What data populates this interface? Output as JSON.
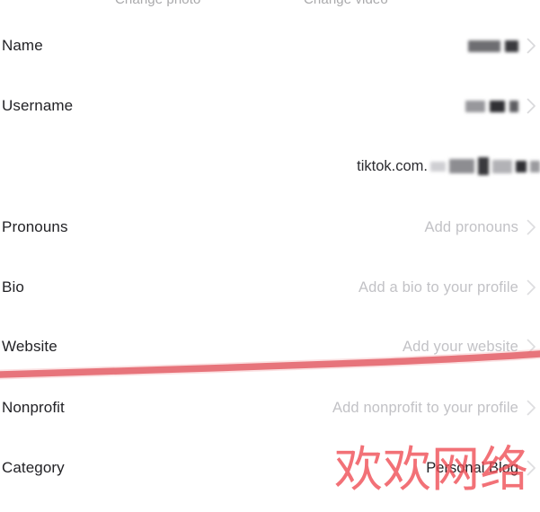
{
  "header": {
    "change_photo_label": "Change photo",
    "change_video_label": "Change video"
  },
  "rows": [
    {
      "label": "Name",
      "value_type": "redacted",
      "chevron": "chevron-right-icon"
    },
    {
      "label": "Username",
      "value_type": "redacted",
      "chevron": "chevron-right-icon"
    },
    {
      "label": "",
      "value": "tiktok.com.",
      "value_type": "url-redacted",
      "chevron": "none"
    },
    {
      "label": "Pronouns",
      "value": "Add pronouns",
      "value_type": "placeholder",
      "chevron": "chevron-right-icon"
    },
    {
      "label": "Bio",
      "value": "Add a bio to your profile",
      "value_type": "placeholder",
      "chevron": "chevron-right-icon"
    },
    {
      "label": "Website",
      "value": "Add your website",
      "value_type": "placeholder",
      "chevron": "chevron-right-icon"
    },
    {
      "label": "Nonprofit",
      "value": "Add nonprofit to your profile",
      "value_type": "placeholder",
      "chevron": "chevron-right-icon"
    },
    {
      "label": "Category",
      "value": "Personal Blog",
      "value_type": "value",
      "chevron": "chevron-right-icon"
    }
  ],
  "annotations": {
    "underline_color": "#e0565f",
    "watermark_text": "欢欢网络",
    "watermark_color": "#ef4a52"
  },
  "colors": {
    "background": "#ffffff",
    "label_text": "#222226",
    "placeholder_text": "#c2c2c6",
    "chevron": "#c9c9cd"
  }
}
